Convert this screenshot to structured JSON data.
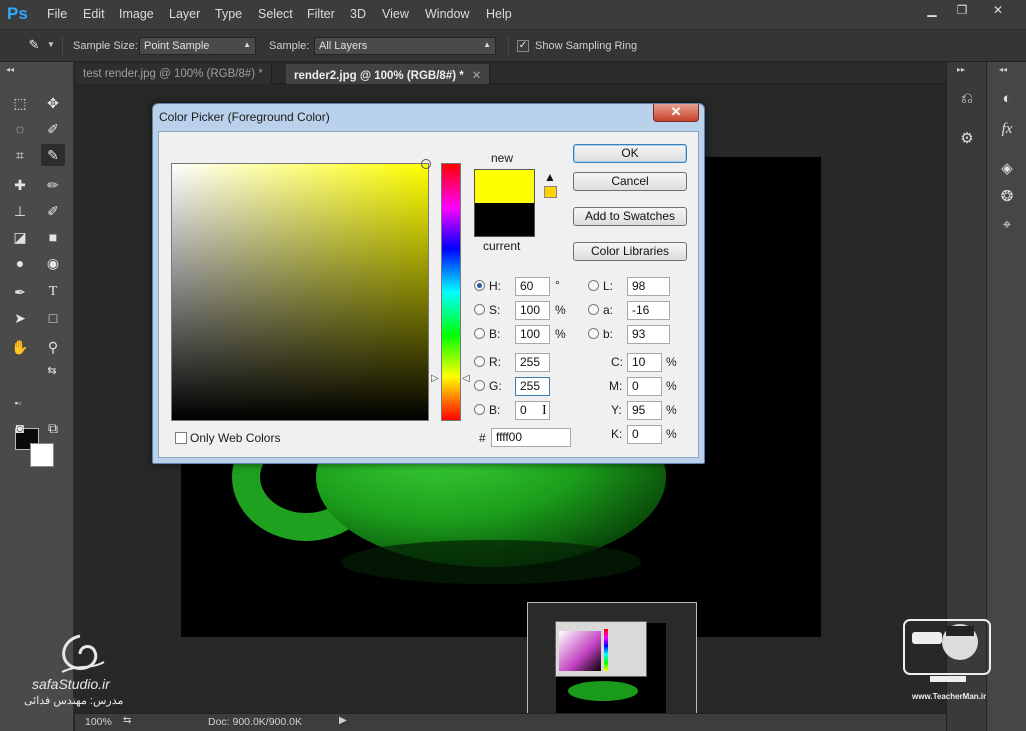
{
  "app": {
    "logo": "Ps"
  },
  "menu": [
    "File",
    "Edit",
    "Image",
    "Layer",
    "Type",
    "Select",
    "Filter",
    "3D",
    "View",
    "Window",
    "Help"
  ],
  "options_bar": {
    "tool_icon": "eyedropper-icon",
    "sample_size_label": "Sample Size:",
    "sample_size_value": "Point Sample",
    "sample_label": "Sample:",
    "sample_value": "All Layers",
    "show_sampling_ring_label": "Show Sampling Ring",
    "show_sampling_ring_checked": true
  },
  "tabs": [
    {
      "label": "test render.jpg @ 100% (RGB/8#) *",
      "active": false
    },
    {
      "label": "render2.jpg @ 100% (RGB/8#) *",
      "active": true
    }
  ],
  "status": {
    "zoom": "100%",
    "doc": "Doc: 900.0K/900.0K"
  },
  "dialog": {
    "title": "Color Picker (Foreground Color)",
    "new_label": "new",
    "current_label": "current",
    "new_color": "#ffff00",
    "current_color": "#000000",
    "buttons": {
      "ok": "OK",
      "cancel": "Cancel",
      "add_swatches": "Add to Swatches",
      "color_libraries": "Color Libraries"
    },
    "only_web_colors": "Only Web Colors",
    "hsb": {
      "h": {
        "label": "H:",
        "value": "60",
        "unit": "°"
      },
      "s": {
        "label": "S:",
        "value": "100",
        "unit": "%"
      },
      "b": {
        "label": "B:",
        "value": "100",
        "unit": "%"
      }
    },
    "rgb": {
      "r": {
        "label": "R:",
        "value": "255"
      },
      "g": {
        "label": "G:",
        "value": "255"
      },
      "b": {
        "label": "B:",
        "value": "0"
      }
    },
    "lab": {
      "l": {
        "label": "L:",
        "value": "98"
      },
      "a": {
        "label": "a:",
        "value": "-16"
      },
      "b": {
        "label": "b:",
        "value": "93"
      }
    },
    "cmyk": {
      "c": {
        "label": "C:",
        "value": "10",
        "unit": "%"
      },
      "m": {
        "label": "M:",
        "value": "0",
        "unit": "%"
      },
      "y": {
        "label": "Y:",
        "value": "95",
        "unit": "%"
      },
      "k": {
        "label": "K:",
        "value": "0",
        "unit": "%"
      }
    },
    "hex_label": "#",
    "hex_value": "ffff00"
  },
  "watermarks": {
    "left_site": "safaStudio.ir",
    "left_teacher": "مدرس: مهندس فدائی",
    "right_site": "www.TeacherMan.ir"
  }
}
